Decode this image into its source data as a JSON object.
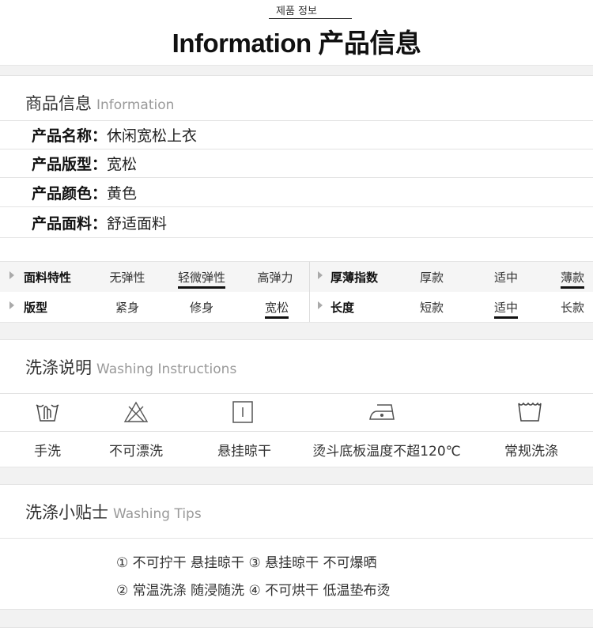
{
  "header": {
    "korean": "제품 정보",
    "title": "Information 产品信息"
  },
  "product_info": {
    "heading": "商品信息",
    "heading_en": "Information",
    "rows": [
      {
        "label": "产品名称：",
        "value": "休闲宽松上衣"
      },
      {
        "label": "产品版型：",
        "value": "宽松"
      },
      {
        "label": "产品颜色：",
        "value": "黄色"
      },
      {
        "label": "产品面料：",
        "value": "舒适面料"
      }
    ]
  },
  "features": [
    {
      "label": "面料特性",
      "options": [
        "无弹性",
        "轻微弹性",
        "高弹力"
      ],
      "selected": 1
    },
    {
      "label": "厚薄指数",
      "options": [
        "厚款",
        "适中",
        "薄款"
      ],
      "selected": 2
    },
    {
      "label": "版型",
      "options": [
        "紧身",
        "修身",
        "宽松"
      ],
      "selected": 2
    },
    {
      "label": "长度",
      "options": [
        "短款",
        "适中",
        "长款"
      ],
      "selected": 1
    }
  ],
  "washing": {
    "heading": "洗涤说明",
    "heading_en": "Washing Instructions",
    "items": [
      {
        "icon": "hand-wash-icon",
        "label": "手洗"
      },
      {
        "icon": "no-bleach-icon",
        "label": "不可漂洗"
      },
      {
        "icon": "hang-dry-icon",
        "label": "悬挂晾干"
      },
      {
        "icon": "iron-low-icon",
        "label": "烫斗底板温度不超120℃"
      },
      {
        "icon": "machine-wash-icon",
        "label": "常规洗涤"
      }
    ]
  },
  "tips": {
    "heading": "洗涤小贴士",
    "heading_en": "Washing Tips",
    "lines": [
      "① 不可拧干  悬挂晾干  ③ 悬挂晾干  不可爆晒",
      "② 常温洗涤  随浸随洗  ④ 不可烘干  低温垫布烫"
    ]
  }
}
